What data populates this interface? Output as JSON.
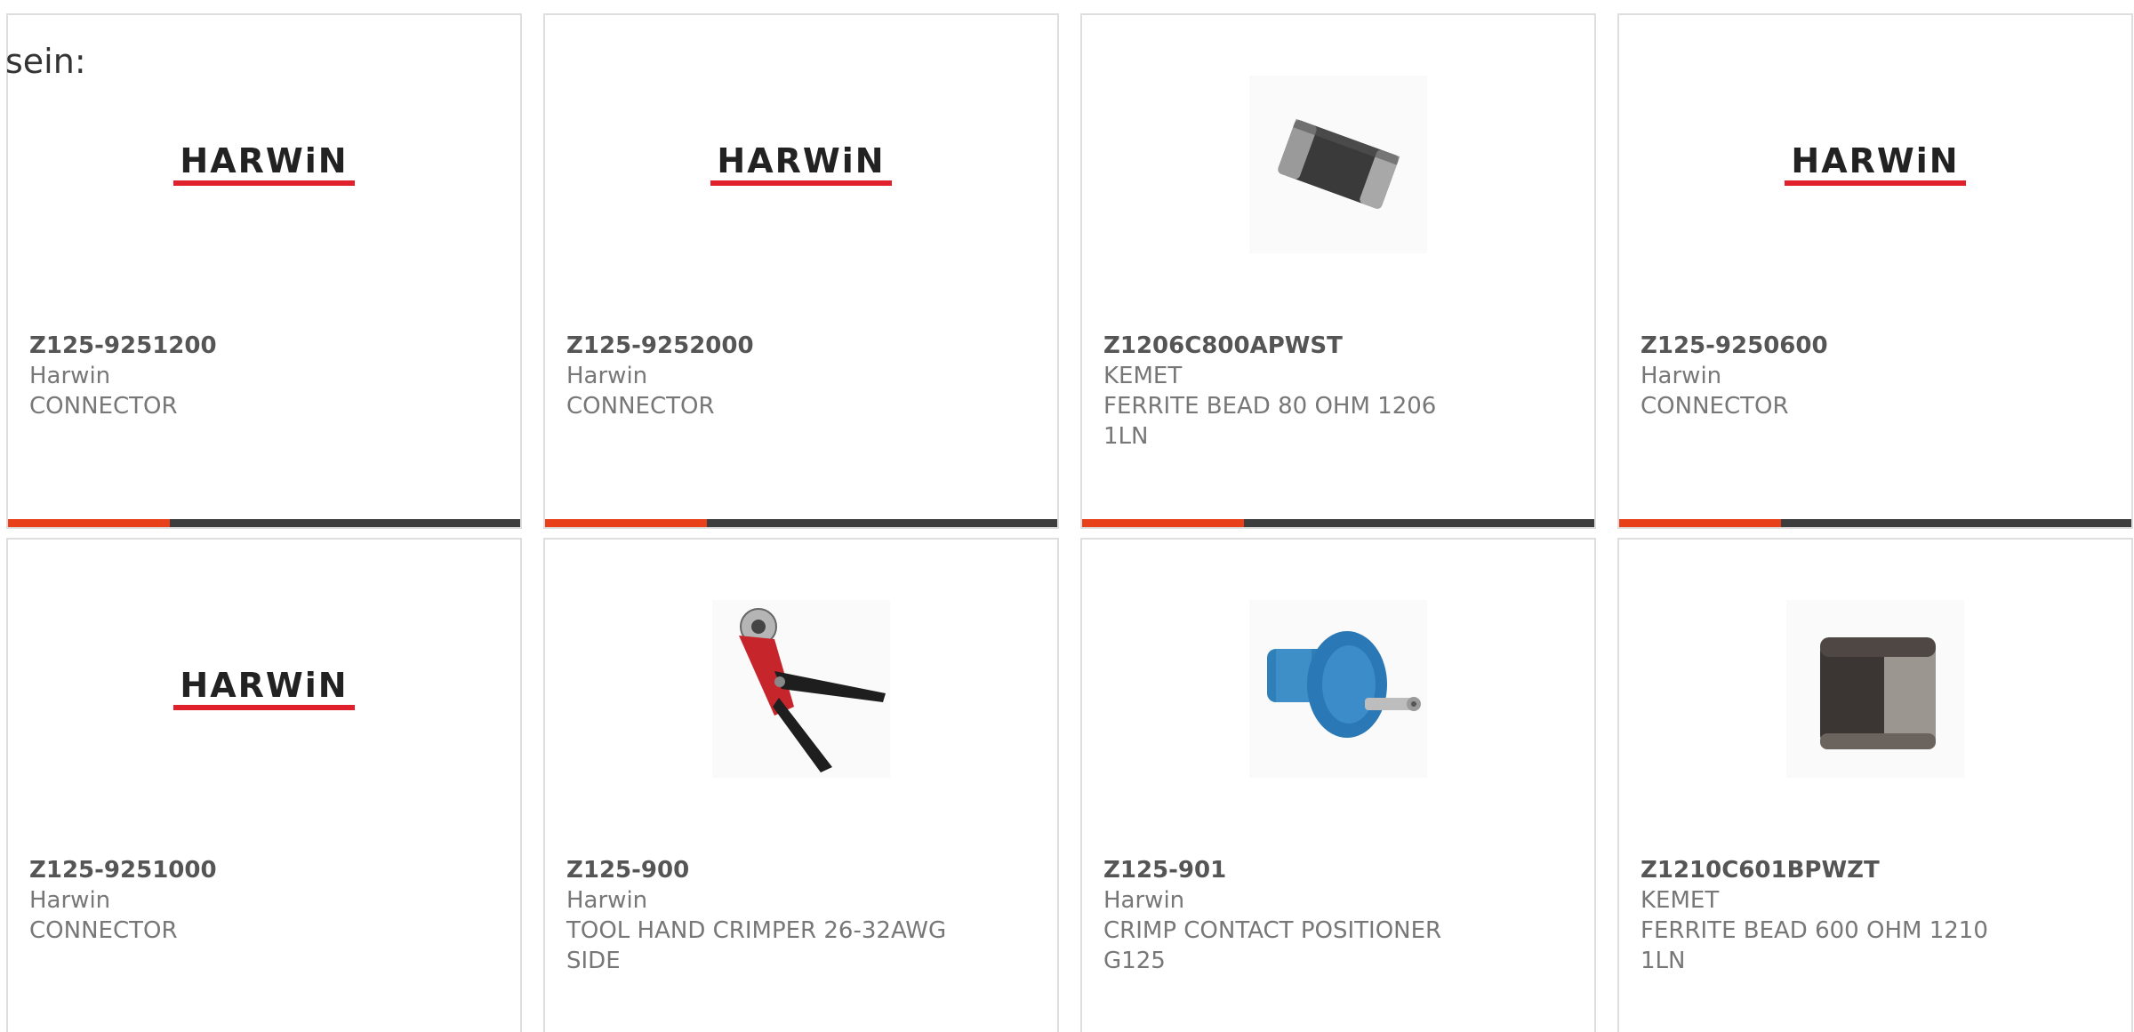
{
  "lead_text": "sein:",
  "products": [
    {
      "part_number": "Z125-9251200",
      "manufacturer": "Harwin",
      "description": "CONNECTOR",
      "image": "harwin-logo",
      "logo_text": "HARWiN"
    },
    {
      "part_number": "Z125-9252000",
      "manufacturer": "Harwin",
      "description": "CONNECTOR",
      "image": "harwin-logo",
      "logo_text": "HARWiN"
    },
    {
      "part_number": "Z1206C800APWST",
      "manufacturer": "KEMET",
      "description": "FERRITE BEAD 80 OHM 1206 1LN",
      "image": "ferrite-bead-photo"
    },
    {
      "part_number": "Z125-9250600",
      "manufacturer": "Harwin",
      "description": "CONNECTOR",
      "image": "harwin-logo",
      "logo_text": "HARWiN"
    },
    {
      "part_number": "Z125-9251000",
      "manufacturer": "Harwin",
      "description": "CONNECTOR",
      "image": "harwin-logo",
      "logo_text": "HARWiN"
    },
    {
      "part_number": "Z125-900",
      "manufacturer": "Harwin",
      "description": "TOOL HAND CRIMPER 26-32AWG SIDE",
      "image": "crimp-tool-photo"
    },
    {
      "part_number": "Z125-901",
      "manufacturer": "Harwin",
      "description": "CRIMP CONTACT POSITIONER G125",
      "image": "positioner-photo"
    },
    {
      "part_number": "Z1210C601BPWZT",
      "manufacturer": "KEMET",
      "description": "FERRITE BEAD 600 OHM 1210 1LN",
      "image": "ferrite-bead-large-photo"
    }
  ],
  "colors": {
    "accent": "#e8411a",
    "bar": "#3d3d3d",
    "logo_red": "#e0202a",
    "border": "#dedede"
  }
}
